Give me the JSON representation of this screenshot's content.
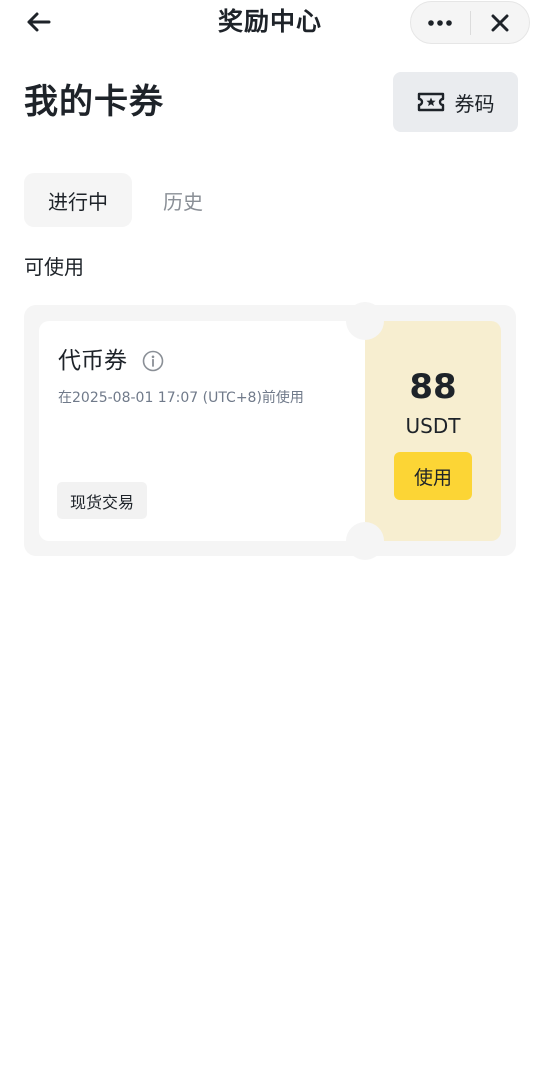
{
  "topbar": {
    "title": "奖励中心",
    "back_icon": "arrow-left-icon",
    "more_icon": "more-dots-icon",
    "close_icon": "close-icon"
  },
  "header": {
    "title": "我的卡券",
    "coupon_code_label": "券码",
    "coupon_code_icon": "ticket-star-icon"
  },
  "tabs": [
    {
      "label": "进行中",
      "active": true
    },
    {
      "label": "历史",
      "active": false
    }
  ],
  "section_label": "可使用",
  "coupon": {
    "name": "代币券",
    "info_icon": "info-icon",
    "expiry": "在2025-08-01 17:07 (UTC+8)前使用",
    "tag": "现货交易",
    "amount": "88",
    "currency": "USDT",
    "use_label": "使用"
  },
  "colors": {
    "accent": "#fcd535",
    "coupon_right_bg": "#f7eed0",
    "card_bg": "#f5f5f5",
    "text_primary": "#1e2329",
    "text_secondary": "#707a8a"
  }
}
